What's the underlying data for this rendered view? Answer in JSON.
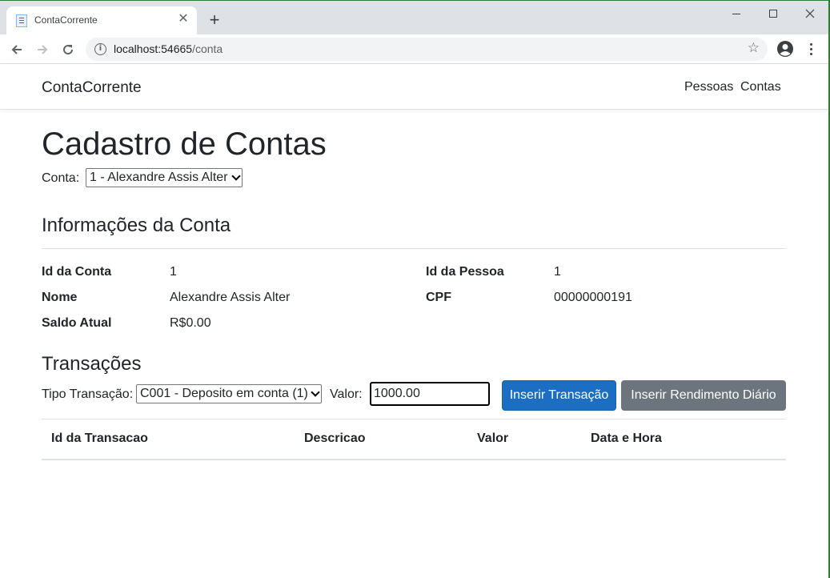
{
  "browser": {
    "tab_title": "ContaCorrente",
    "url_host": "localhost:54665",
    "url_path": "/conta"
  },
  "navbar": {
    "brand": "ContaCorrente",
    "links": [
      "Pessoas",
      "Contas"
    ]
  },
  "page": {
    "title": "Cadastro de Contas",
    "conta_label": "Conta:",
    "conta_selected": "1 - Alexandre Assis Alter"
  },
  "info": {
    "heading": "Informações da Conta",
    "fields": [
      {
        "label": "Id da Conta",
        "value": "1"
      },
      {
        "label": "Nome",
        "value": "Alexandre Assis Alter"
      },
      {
        "label": "Saldo Atual",
        "value": "R$0.00"
      },
      {
        "label": "Id da Pessoa",
        "value": "1"
      },
      {
        "label": "CPF",
        "value": "00000000191"
      }
    ]
  },
  "transacoes": {
    "heading": "Transações",
    "tipo_label": "Tipo Transação:",
    "tipo_selected": "C001 - Deposito em conta (1)",
    "valor_label": "Valor:",
    "valor_value": "1000.00",
    "btn_inserir": "Inserir Transação",
    "btn_rendimento": "Inserir Rendimento Diário",
    "columns": [
      "Id da Transacao",
      "Descricao",
      "Valor",
      "Data e Hora"
    ]
  },
  "colors": {
    "primary": "#1b6ec2",
    "secondary": "#6c757d"
  }
}
